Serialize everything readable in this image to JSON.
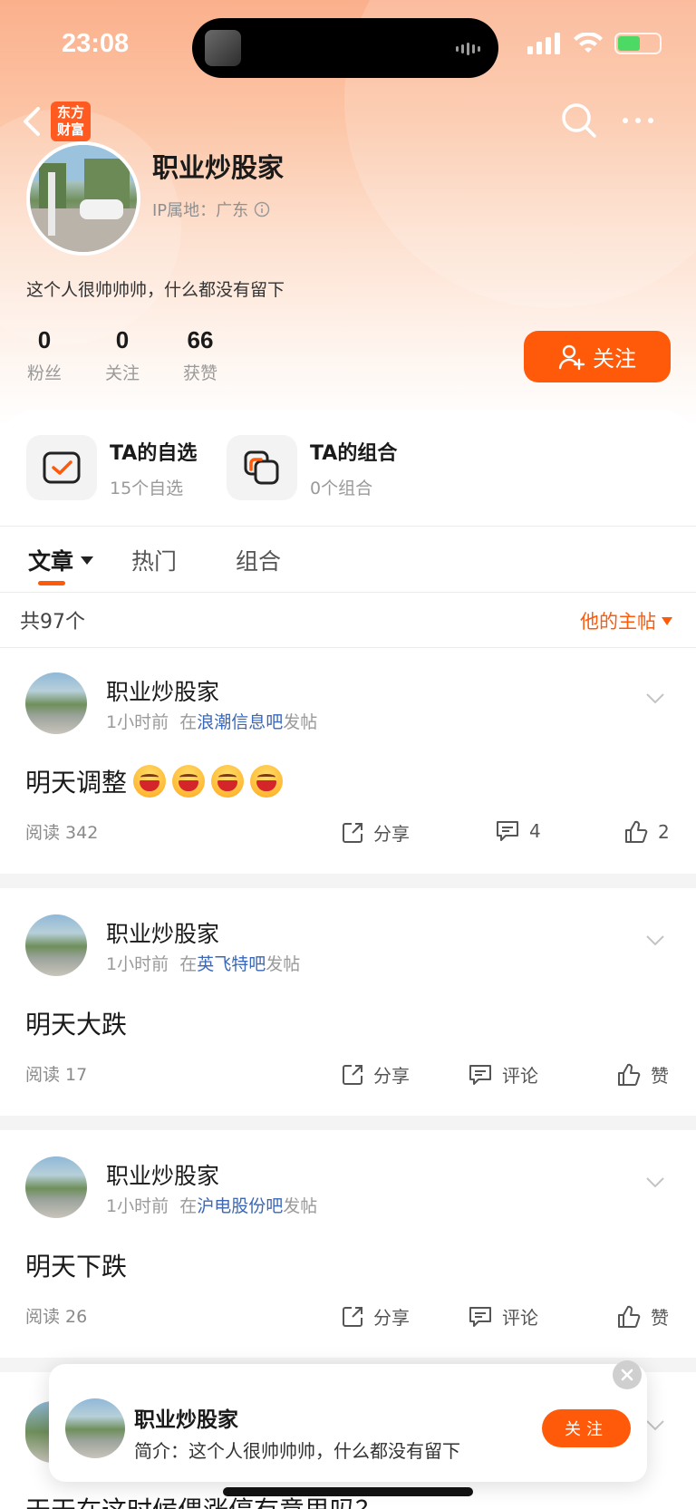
{
  "status_bar": {
    "time": "23:08"
  },
  "header": {
    "brand_badge_line1": "东方",
    "brand_badge_line2": "财富"
  },
  "profile": {
    "name": "职业炒股家",
    "ip_location": "IP属地：广东",
    "bio": "这个人很帅帅帅，什么都没有留下",
    "stats": [
      {
        "value": "0",
        "label": "粉丝"
      },
      {
        "value": "0",
        "label": "关注"
      },
      {
        "value": "66",
        "label": "获赞"
      }
    ],
    "follow_label": "关注"
  },
  "features": [
    {
      "title": "TA的自选",
      "subtitle": "15个自选"
    },
    {
      "title": "TA的组合",
      "subtitle": "0个组合"
    }
  ],
  "tabs": [
    {
      "label": "文章"
    },
    {
      "label": "热门"
    },
    {
      "label": "组合"
    }
  ],
  "list_header": {
    "count": "共97个",
    "filter": "他的主帖"
  },
  "posts": [
    {
      "author": "职业炒股家",
      "time": "1小时前",
      "in": "在",
      "forum": "浪潮信息吧",
      "suffix": "发帖",
      "title": "明天调整",
      "emoji_count": 4,
      "reads": "阅读 342",
      "share": "分享",
      "comments": "4",
      "likes": "2"
    },
    {
      "author": "职业炒股家",
      "time": "1小时前",
      "in": "在",
      "forum": "英飞特吧",
      "suffix": "发帖",
      "title": "明天大跌",
      "reads": "阅读 17",
      "share": "分享",
      "comments": "评论",
      "likes": "赞"
    },
    {
      "author": "职业炒股家",
      "time": "1小时前",
      "in": "在",
      "forum": "沪电股份吧",
      "suffix": "发帖",
      "title": "明天下跌",
      "reads": "阅读 26",
      "share": "分享",
      "comments": "评论",
      "likes": "赞"
    }
  ],
  "popup": {
    "name": "职业炒股家",
    "bio": "简介：这个人很帅帅帅，什么都没有留下",
    "follow_label": "关注"
  },
  "partial_post_title": "天天在这时候偎涨停有意思吗？",
  "colors": {
    "accent": "#ff5a0a",
    "link": "#3a67b8"
  }
}
